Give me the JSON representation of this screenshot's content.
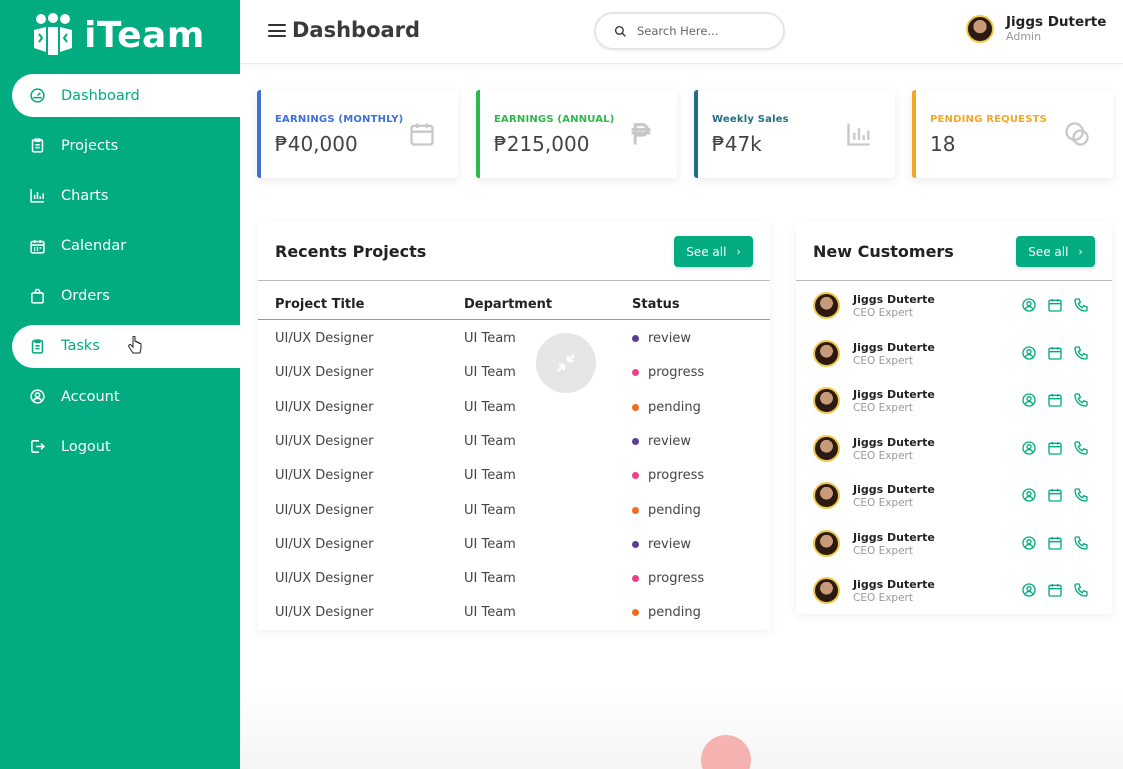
{
  "app": {
    "name": "iTeam"
  },
  "sidebar": {
    "items": [
      {
        "label": "Dashboard",
        "icon": "dashboard-icon"
      },
      {
        "label": "Projects",
        "icon": "clipboard-icon"
      },
      {
        "label": "Charts",
        "icon": "chart-icon"
      },
      {
        "label": "Calendar",
        "icon": "calendar-icon"
      },
      {
        "label": "Orders",
        "icon": "bag-icon"
      },
      {
        "label": "Tasks",
        "icon": "tasks-icon"
      },
      {
        "label": "Account",
        "icon": "account-icon"
      },
      {
        "label": "Logout",
        "icon": "logout-icon"
      }
    ],
    "active": "Dashboard",
    "hovered": "Tasks"
  },
  "header": {
    "title": "Dashboard",
    "search_placeholder": "Search Here...",
    "user_name": "Jiggs Duterte",
    "user_role": "Admin"
  },
  "cards": [
    {
      "label": "EARNINGS (MONTHLY)",
      "value": "₱40,000",
      "color": "#3f6fd8",
      "icon": "calendar-icon"
    },
    {
      "label": "EARNINGS (ANNUAL)",
      "value": "₱215,000",
      "color": "#2db84a",
      "icon": "peso-icon"
    },
    {
      "label": "Weekly Sales",
      "value": "₱47k",
      "color": "#1f6f86",
      "icon": "chart-icon"
    },
    {
      "label": "PENDING REQUESTS",
      "value": "18",
      "color": "#f5a623",
      "icon": "chat-icon"
    }
  ],
  "projects": {
    "title": "Recents Projects",
    "see_all": "See all",
    "columns": [
      "Project Title",
      "Department",
      "Status"
    ],
    "rows": [
      {
        "title": "UI/UX Designer",
        "dept": "UI Team",
        "status": "review"
      },
      {
        "title": "UI/UX Designer",
        "dept": "UI Team",
        "status": "progress"
      },
      {
        "title": "UI/UX Designer",
        "dept": "UI Team",
        "status": "pending"
      },
      {
        "title": "UI/UX Designer",
        "dept": "UI Team",
        "status": "review"
      },
      {
        "title": "UI/UX Designer",
        "dept": "UI Team",
        "status": "progress"
      },
      {
        "title": "UI/UX Designer",
        "dept": "UI Team",
        "status": "pending"
      },
      {
        "title": "UI/UX Designer",
        "dept": "UI Team",
        "status": "review"
      },
      {
        "title": "UI/UX Designer",
        "dept": "UI Team",
        "status": "progress"
      },
      {
        "title": "UI/UX Designer",
        "dept": "UI Team",
        "status": "pending"
      }
    ],
    "status_colors": {
      "review": "#5b3f8f",
      "progress": "#ee3f8a",
      "pending": "#f26b1d"
    }
  },
  "customers": {
    "title": "New Customers",
    "see_all": "See all",
    "items": [
      {
        "name": "Jiggs Duterte",
        "role": "CEO Expert"
      },
      {
        "name": "Jiggs Duterte",
        "role": "CEO Expert"
      },
      {
        "name": "Jiggs Duterte",
        "role": "CEO Expert"
      },
      {
        "name": "Jiggs Duterte",
        "role": "CEO Expert"
      },
      {
        "name": "Jiggs Duterte",
        "role": "CEO Expert"
      },
      {
        "name": "Jiggs Duterte",
        "role": "CEO Expert"
      },
      {
        "name": "Jiggs Duterte",
        "role": "CEO Expert"
      }
    ]
  },
  "theme": {
    "primary": "#02ac80"
  }
}
